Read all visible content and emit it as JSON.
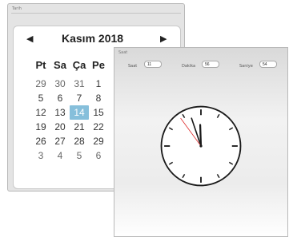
{
  "date_panel": {
    "title": "Tarih",
    "nav_prev_glyph": "◀",
    "nav_next_glyph": "▶",
    "month_label": "Kasım 2018",
    "weekdays": [
      "Pt",
      "Sa",
      "Ça",
      "Pe",
      "C"
    ],
    "weeks": [
      [
        "29",
        "30",
        "31",
        "1",
        ""
      ],
      [
        "5",
        "6",
        "7",
        "8",
        ""
      ],
      [
        "12",
        "13",
        "14",
        "15",
        "1"
      ],
      [
        "19",
        "20",
        "21",
        "22",
        "2"
      ],
      [
        "26",
        "27",
        "28",
        "29",
        "3"
      ],
      [
        "3",
        "4",
        "5",
        "6",
        ""
      ]
    ],
    "selected_day": "14"
  },
  "time_panel": {
    "title": "Saat",
    "hour_label": "Saat",
    "hour_value": "11",
    "minute_label": "Dakika",
    "minute_value": "56",
    "second_label": "Saniye",
    "second_value": "54"
  },
  "clock": {
    "hour": 11,
    "minute": 56,
    "second": 54,
    "second_hand_color": "#e03030"
  },
  "colors": {
    "selected_day_bg": "#86bfdb"
  }
}
